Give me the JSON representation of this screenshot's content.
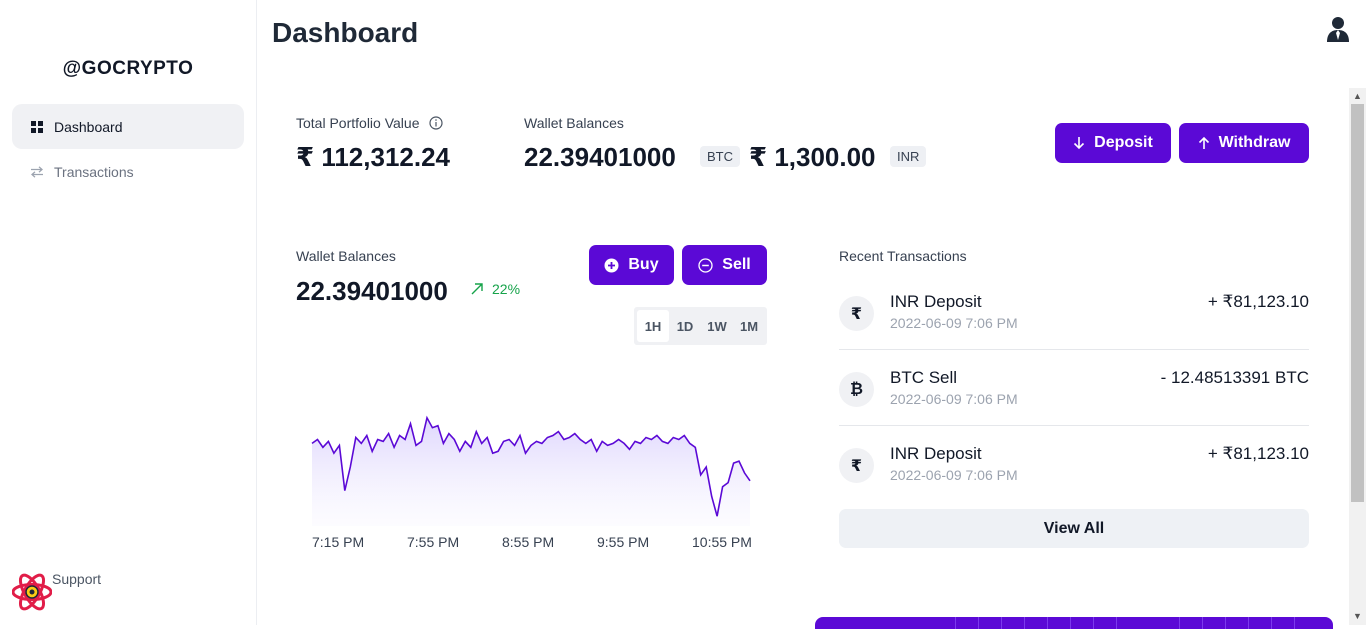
{
  "brand": "@GOCRYPTO",
  "sidebar": {
    "items": [
      {
        "label": "Dashboard",
        "icon": "grid-icon",
        "active": true
      },
      {
        "label": "Transactions",
        "icon": "arrows-exchange-icon",
        "active": false
      }
    ],
    "support_label": "Support"
  },
  "header": {
    "title": "Dashboard"
  },
  "portfolio": {
    "label": "Total Portfolio Value",
    "value": "₹ 112,312.24"
  },
  "wallet_top": {
    "label": "Wallet Balances",
    "btc_value": "22.39401000",
    "btc_tag": "BTC",
    "inr_value": "₹ 1,300.00",
    "inr_tag": "INR"
  },
  "actions": {
    "deposit": "Deposit",
    "withdraw": "Withdraw"
  },
  "wallet_chart": {
    "label": "Wallet Balances",
    "value": "22.39401000",
    "change": "22%",
    "buy": "Buy",
    "sell": "Sell",
    "ranges": [
      "1H",
      "1D",
      "1W",
      "1M"
    ],
    "selected_range": "1H"
  },
  "chart_data": {
    "type": "area",
    "x_ticks": [
      "7:15 PM",
      "7:55 PM",
      "8:55 PM",
      "9:55 PM",
      "10:55 PM"
    ],
    "values": [
      62,
      64,
      60,
      63,
      57,
      61,
      38,
      50,
      65,
      62,
      66,
      58,
      64,
      63,
      67,
      60,
      66,
      64,
      72,
      61,
      63,
      75,
      70,
      71,
      62,
      67,
      64,
      58,
      63,
      60,
      68,
      62,
      65,
      57,
      58,
      63,
      64,
      61,
      66,
      57,
      61,
      63,
      62,
      65,
      66,
      68,
      64,
      65,
      67,
      64,
      62,
      64,
      58,
      63,
      61,
      62,
      64,
      62,
      59,
      63,
      62,
      65,
      64,
      66,
      63,
      62,
      65,
      64,
      66,
      62,
      60,
      46,
      50,
      35,
      25,
      40,
      42,
      52,
      53,
      47,
      43
    ],
    "color": "#5b09d6"
  },
  "recent": {
    "label": "Recent Transactions",
    "rows": [
      {
        "symbol": "₹",
        "name": "INR Deposit",
        "date": "2022-06-09 7:06 PM",
        "amount": "+ ₹81,123.10"
      },
      {
        "symbol": "₿",
        "name": "BTC Sell",
        "date": "2022-06-09 7:06 PM",
        "amount": "- 12.48513391 BTC"
      },
      {
        "symbol": "₹",
        "name": "INR Deposit",
        "date": "2022-06-09 7:06 PM",
        "amount": "+ ₹81,123.10"
      }
    ],
    "view_all": "View All"
  },
  "colors": {
    "accent": "#5b09d6",
    "positive": "#16a34a"
  }
}
